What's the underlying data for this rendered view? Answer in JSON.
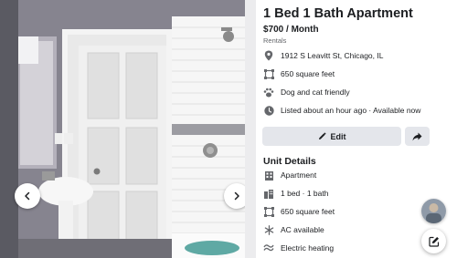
{
  "listing": {
    "title": "1 Bed 1 Bath Apartment",
    "price": "$700 / Month",
    "category": "Rentals",
    "facts": [
      {
        "icon": "location-pin-icon",
        "text": "1912 S Leavitt St, Chicago, IL"
      },
      {
        "icon": "square-feet-icon",
        "text": "650 square feet"
      },
      {
        "icon": "paw-icon",
        "text": "Dog and cat friendly"
      },
      {
        "icon": "clock-icon",
        "text": "Listed about an hour ago · Available now"
      }
    ]
  },
  "actions": {
    "edit_label": "Edit",
    "edit_icon": "pencil-icon",
    "share_icon": "share-arrow-icon"
  },
  "unit_details": {
    "heading": "Unit Details",
    "items": [
      {
        "icon": "building-icon",
        "text": "Apartment"
      },
      {
        "icon": "bed-bath-icon",
        "text": "1 bed · 1 bath"
      },
      {
        "icon": "square-feet-icon",
        "text": "650 square feet"
      },
      {
        "icon": "snowflake-icon",
        "text": "AC available"
      },
      {
        "icon": "heating-icon",
        "text": "Electric heating"
      }
    ]
  },
  "photo": {
    "subject": "bathroom",
    "prev_icon": "chevron-left-icon",
    "next_icon": "chevron-right-icon"
  },
  "floating": {
    "avatar_icon": "avatar",
    "compose_icon": "compose-icon"
  },
  "colors": {
    "button_bg": "#e4e6eb",
    "secondary_text": "#65676b",
    "icon_gray": "#65676b"
  }
}
